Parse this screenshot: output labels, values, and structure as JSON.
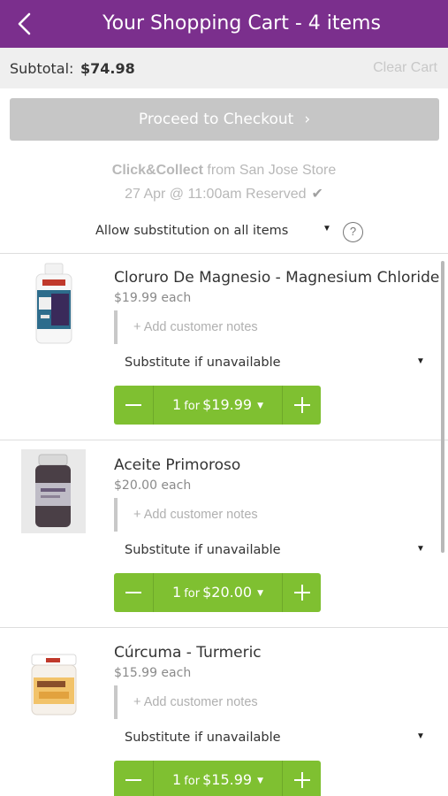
{
  "header": {
    "title": "Your Shopping Cart - 4 items",
    "back_icon": "chevron-left-icon"
  },
  "subtotal": {
    "label": "Subtotal:",
    "value": "$74.98",
    "clear_label": "Clear Cart"
  },
  "checkout": {
    "label": "Proceed to Checkout",
    "chevron": "›"
  },
  "collect": {
    "brand": "Click&Collect",
    "store": "from San Jose Store",
    "reservation": "27 Apr @ 11:00am Reserved",
    "check": "✔"
  },
  "substitution_all": {
    "label": "Allow substitution on all items",
    "arrow": "▼",
    "help": "?"
  },
  "items": [
    {
      "name": "Cloruro De Magnesio - Magnesium Chloride",
      "price_each": "$19.99 each",
      "notes_placeholder": "+ Add customer notes",
      "substitute": "Substitute if unavailable",
      "substitute_arrow": "▼",
      "qty": "1",
      "qty_for": "for",
      "qty_price": "$19.99",
      "qty_caret": "▼"
    },
    {
      "name": "Aceite Primoroso",
      "price_each": "$20.00 each",
      "notes_placeholder": "+ Add customer notes",
      "substitute": "Substitute if unavailable",
      "substitute_arrow": "▼",
      "qty": "1",
      "qty_for": "for",
      "qty_price": "$20.00",
      "qty_caret": "▼"
    },
    {
      "name": "Cúrcuma - Turmeric",
      "price_each": "$15.99 each",
      "notes_placeholder": "+ Add customer notes",
      "substitute": "Substitute if unavailable",
      "substitute_arrow": "▼",
      "qty": "1",
      "qty_for": "for",
      "qty_price": "$15.99",
      "qty_caret": "▼"
    }
  ],
  "colors": {
    "header_bg": "#7b2f8d",
    "accent_green": "#7fc031",
    "checkout_disabled": "#c6c6c6"
  }
}
